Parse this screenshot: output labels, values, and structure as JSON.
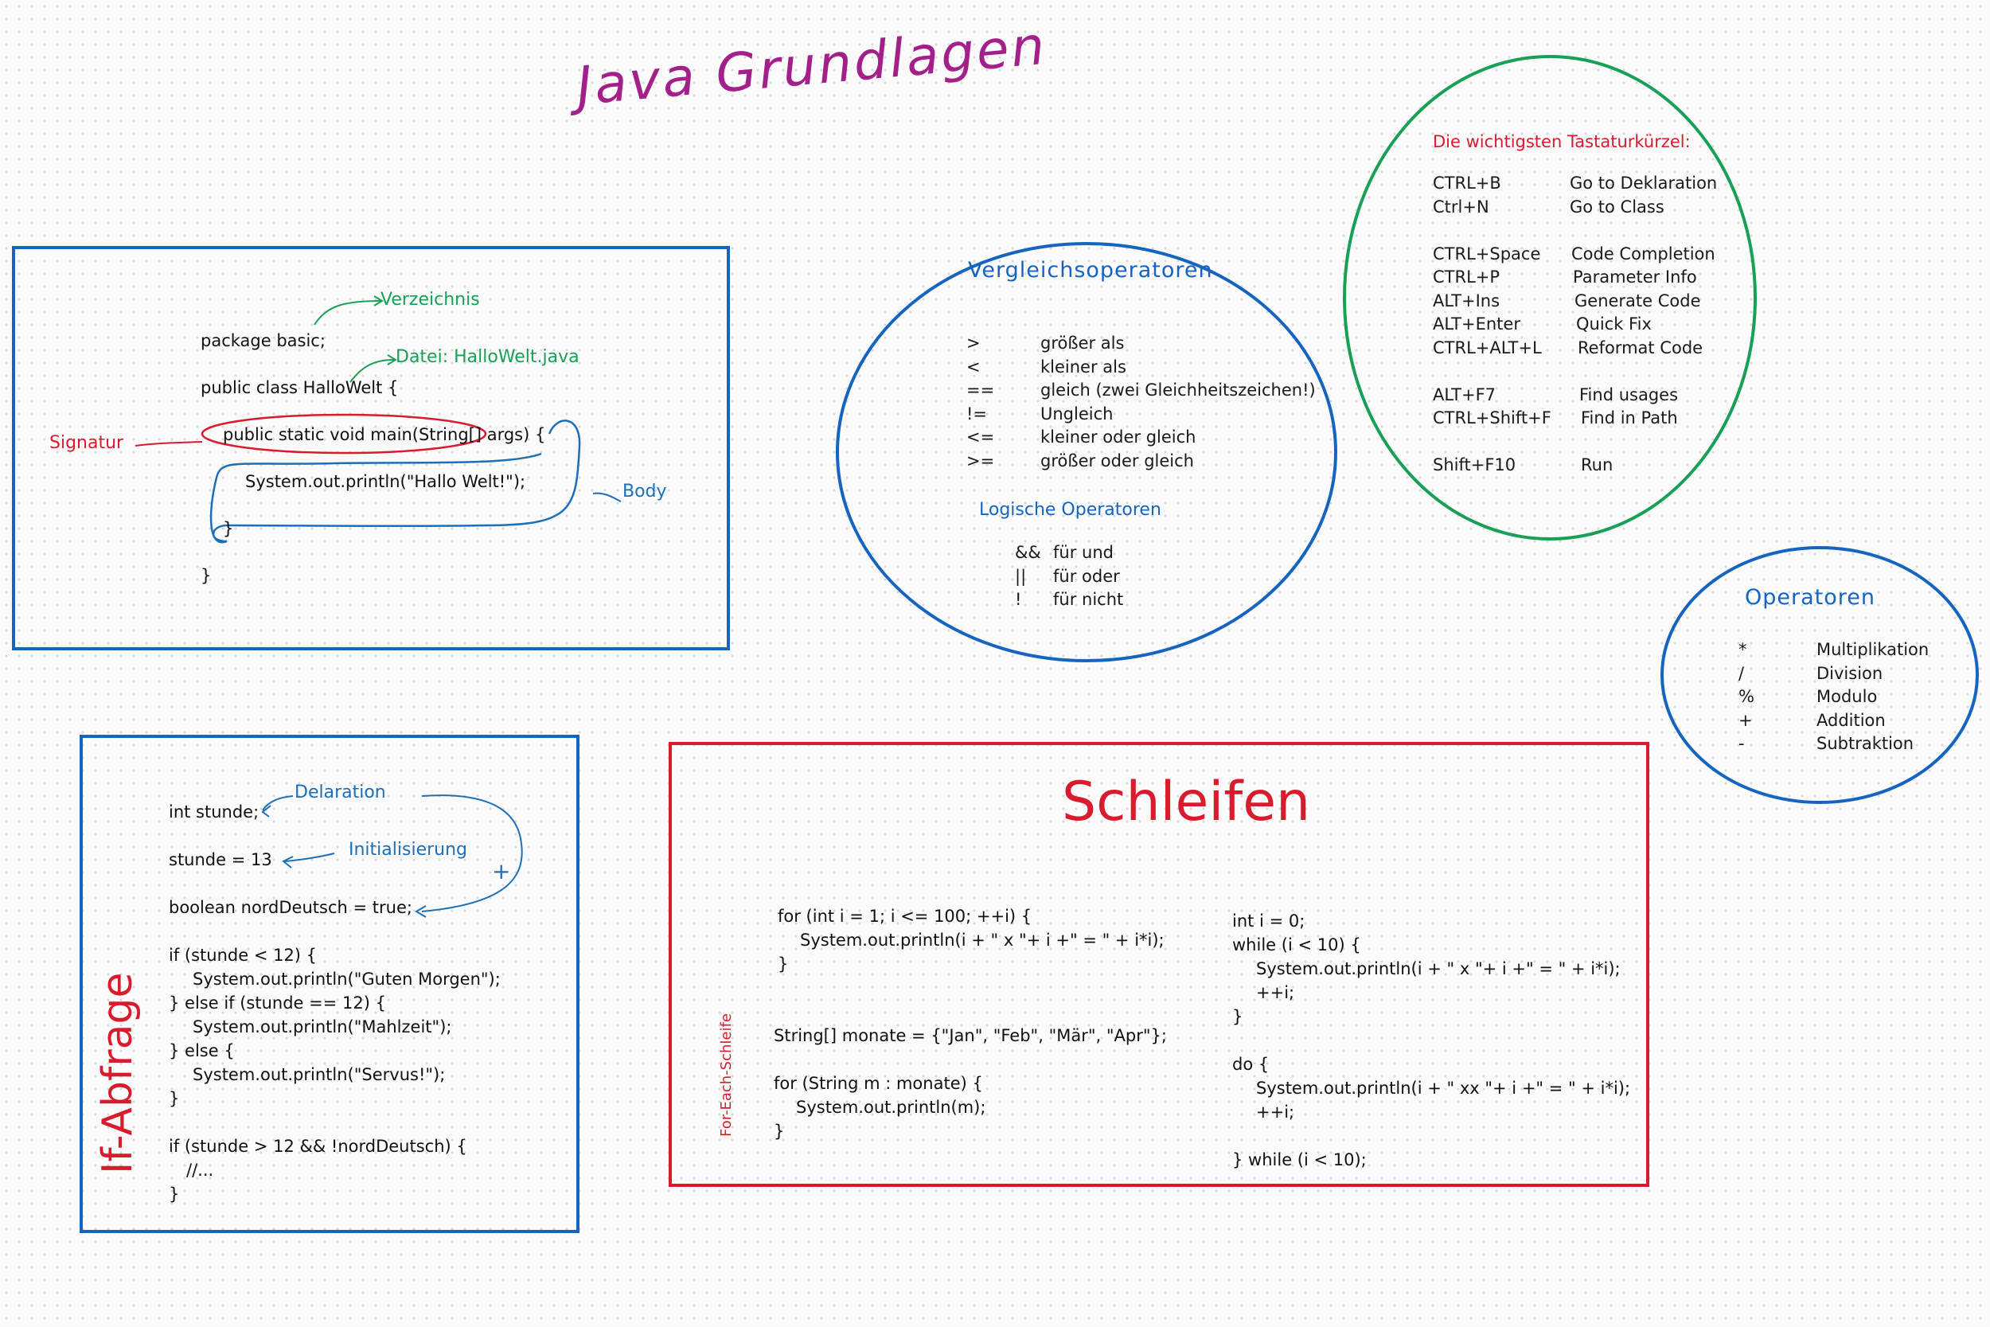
{
  "title": "Java Grundlagen",
  "hello_box": {
    "code": [
      "package basic;",
      "public class HalloWelt {",
      "public static void main(String[] args) {",
      "System.out.println(\"Hallo Welt!\");",
      "}",
      "}"
    ],
    "annotations": {
      "verzeichnis": "Verzeichnis",
      "datei": "Datei: HalloWelt.java",
      "signatur": "Signatur",
      "body": "Body"
    }
  },
  "vergleich": {
    "title": "Vergleichsoperatoren",
    "items": [
      {
        "op": ">",
        "desc": "größer als"
      },
      {
        "op": "<",
        "desc": "kleiner als"
      },
      {
        "op": "==",
        "desc": "gleich (zwei Gleichheitszeichen!)"
      },
      {
        "op": "!=",
        "desc": "Ungleich"
      },
      {
        "op": "<=",
        "desc": "kleiner oder gleich"
      },
      {
        "op": ">=",
        "desc": "größer oder gleich"
      }
    ],
    "logic_title": "Logische Operatoren",
    "logic_items": [
      {
        "op": "&&",
        "desc": "für und"
      },
      {
        "op": "||",
        "desc": "für oder"
      },
      {
        "op": "!",
        "desc": "für nicht"
      }
    ]
  },
  "shortcuts": {
    "title": "Die wichtigsten Tastaturkürzel:",
    "items": [
      {
        "key": "CTRL+B",
        "desc": "Go to Deklaration"
      },
      {
        "key": "Ctrl+N",
        "desc": "Go to Class"
      },
      {
        "key": "CTRL+Space",
        "desc": "Code Completion"
      },
      {
        "key": "CTRL+P",
        "desc": "Parameter Info"
      },
      {
        "key": "ALT+Ins",
        "desc": "Generate Code"
      },
      {
        "key": "ALT+Enter",
        "desc": "Quick Fix"
      },
      {
        "key": "CTRL+ALT+L",
        "desc": "Reformat Code"
      },
      {
        "key": "ALT+F7",
        "desc": "Find usages"
      },
      {
        "key": "CTRL+Shift+F",
        "desc": "Find in Path"
      },
      {
        "key": "Shift+F10",
        "desc": "Run"
      }
    ]
  },
  "operatoren": {
    "title": "Operatoren",
    "items": [
      {
        "op": "*",
        "desc": "Multiplikation"
      },
      {
        "op": "/",
        "desc": "Division"
      },
      {
        "op": "%",
        "desc": "Modulo"
      },
      {
        "op": "+",
        "desc": "Addition"
      },
      {
        "op": "-",
        "desc": "Subtraktion"
      }
    ]
  },
  "if_box": {
    "label": "If-Abfrage",
    "code": [
      "int stunde;",
      "",
      "stunde = 13",
      "",
      "boolean nordDeutsch = true;",
      "",
      "if (stunde < 12) {",
      "System.out.println(\"Guten Morgen\");",
      "} else if (stunde == 12) {",
      "System.out.println(\"Mahlzeit\");",
      "} else {",
      "System.out.println(\"Servus!\");",
      "}",
      "",
      "if (stunde > 12 && !nordDeutsch) {",
      "//...",
      "}"
    ],
    "annotations": {
      "deklaration": "Delaration",
      "initialisierung": "Initialisierung",
      "plus": "+"
    }
  },
  "loops_box": {
    "title": "Schleifen",
    "foreach_label": "For-Each-Schleife",
    "left_code": [
      "for (int i = 1; i <= 100; ++i) {",
      "System.out.println(i + \" x \"+ i +\" = \" + i*i);",
      "}",
      "",
      "",
      "String[] monate = {\"Jan\", \"Feb\", \"Mär\", \"Apr\"};",
      "",
      "for (String m : monate) {",
      "System.out.println(m);",
      "}"
    ],
    "right_code": [
      "int i = 0;",
      "while (i < 10) {",
      "System.out.println(i + \" x \"+ i +\" = \" + i*i);",
      "++i;",
      "}",
      "",
      "do {",
      "System.out.println(i + \" xx \"+ i +\" = \" + i*i);",
      "++i;",
      "",
      "} while (i < 10);"
    ]
  },
  "colors": {
    "blue": "#1565c0",
    "green": "#18a058",
    "red": "#d81c2e",
    "purple": "#a3208a"
  }
}
